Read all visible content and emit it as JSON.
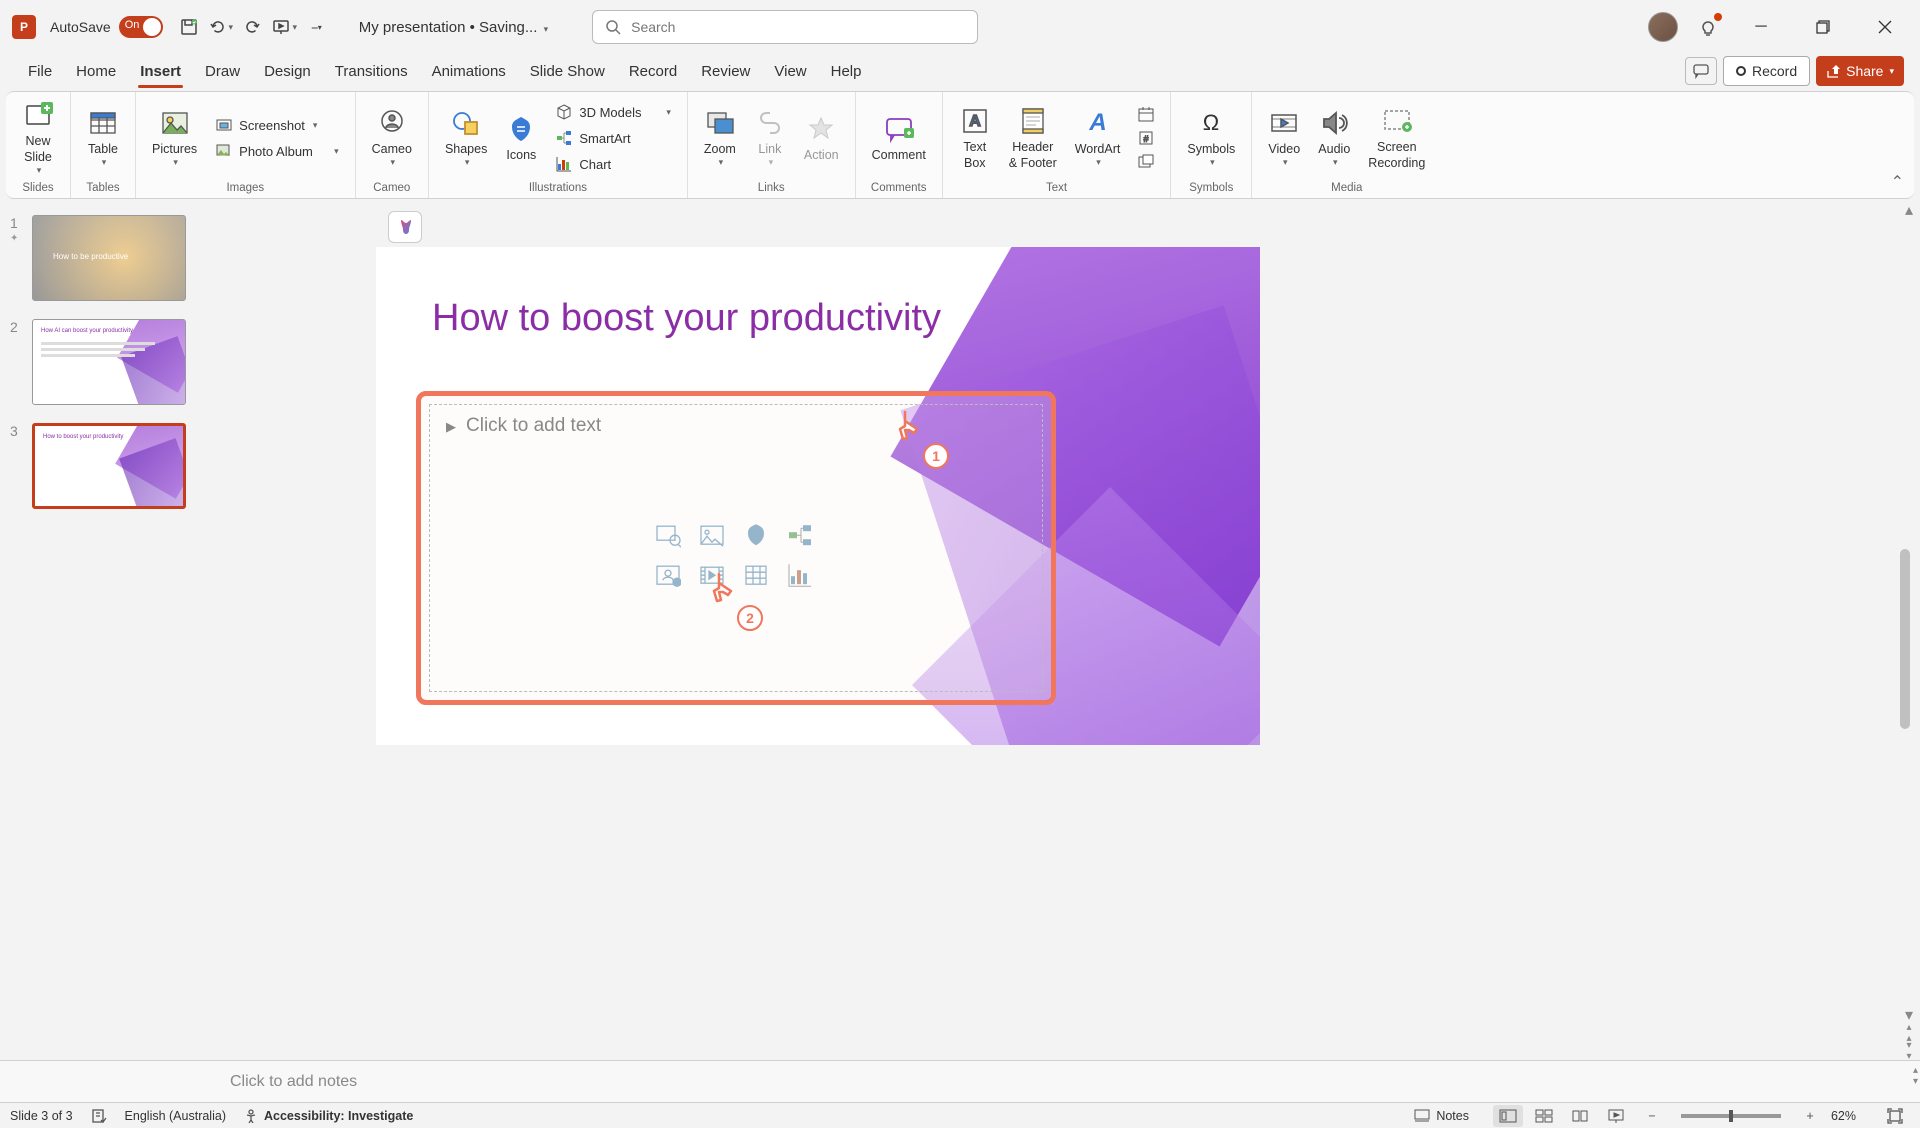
{
  "title_bar": {
    "autosave_label": "AutoSave",
    "autosave_state": "On",
    "document_title": "My presentation • Saving...",
    "search_placeholder": "Search"
  },
  "tabs": {
    "items": [
      "File",
      "Home",
      "Insert",
      "Draw",
      "Design",
      "Transitions",
      "Animations",
      "Slide Show",
      "Record",
      "Review",
      "View",
      "Help"
    ],
    "active_index": 2,
    "record_label": "Record",
    "share_label": "Share"
  },
  "ribbon": {
    "groups": {
      "slides": {
        "label": "Slides",
        "new_slide": "New\nSlide"
      },
      "tables": {
        "label": "Tables",
        "table": "Table"
      },
      "images": {
        "label": "Images",
        "pictures": "Pictures",
        "screenshot": "Screenshot",
        "photo_album": "Photo Album"
      },
      "cameo": {
        "label": "Cameo",
        "cameo": "Cameo"
      },
      "illustrations": {
        "label": "Illustrations",
        "shapes": "Shapes",
        "icons": "Icons",
        "models": "3D Models",
        "smartart": "SmartArt",
        "chart": "Chart"
      },
      "links": {
        "label": "Links",
        "zoom": "Zoom",
        "link": "Link",
        "action": "Action"
      },
      "comments": {
        "label": "Comments",
        "comment": "Comment"
      },
      "text": {
        "label": "Text",
        "textbox": "Text\nBox",
        "header": "Header\n& Footer",
        "wordart": "WordArt"
      },
      "symbols": {
        "label": "Symbols",
        "symbols": "Symbols"
      },
      "media": {
        "label": "Media",
        "video": "Video",
        "audio": "Audio",
        "screen": "Screen\nRecording"
      }
    }
  },
  "thumbnails": [
    {
      "num": "1",
      "title": "How to be productive"
    },
    {
      "num": "2",
      "title": "How AI can boost your productivity"
    },
    {
      "num": "3",
      "title": "How to boost your productivity"
    }
  ],
  "slide": {
    "title": "How to boost your productivity",
    "placeholder": "Click to add text"
  },
  "annotations": {
    "cursor1": "1",
    "cursor2": "2"
  },
  "notes": {
    "placeholder": "Click to add notes"
  },
  "status": {
    "slide_count": "Slide 3 of 3",
    "language": "English (Australia)",
    "accessibility": "Accessibility: Investigate",
    "notes_btn": "Notes",
    "zoom": "62%"
  }
}
